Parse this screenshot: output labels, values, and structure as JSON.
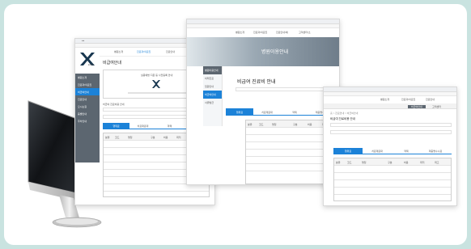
{
  "win1": {
    "logo_text": "EXPO",
    "nav": [
      "병원소개",
      "진료과/의료진",
      "진료안내",
      "고객소통센터"
    ],
    "page_title": "비급여안내",
    "sidebar": [
      "병원소개",
      "진료과/의료진",
      "비급여안내",
      "진료안내",
      "오시는길",
      "층별안내",
      "주차안내"
    ],
    "notice_title": "실종예방 지문 등 사전등록 안내",
    "section_title": "비급여 진료비용 안내",
    "tabs": [
      "행위료",
      "치료재료대",
      "약제",
      "제증명수수료"
    ],
    "table_headers": [
      "분류",
      "코드",
      "명칭",
      "구분",
      "비용",
      "최저",
      "최고",
      "특이사항"
    ]
  },
  "win2": {
    "nav": [
      "병원소개",
      "진료과/의료진",
      "진료안내/예",
      "고객센터/소"
    ],
    "banner_text": "병원이용안내",
    "page_title": "비급여 진료비 안내",
    "sidebar": [
      "병원이용안내",
      "외래진료",
      "입원안내",
      "비급여안내",
      "서류발급"
    ],
    "tabs": [
      "행위료",
      "치료재료대",
      "약제",
      "제증명수수료"
    ],
    "table_headers": [
      "분류",
      "코드",
      "명칭",
      "구분",
      "비용",
      "최저"
    ]
  },
  "win3": {
    "nav": [
      "병원소개",
      "진료과/의료진",
      "진료안내",
      "비급여안내",
      "고객센터"
    ],
    "breadcrumb": "홈 > 진료안내 > 비급여안내",
    "section_title": "비급여 진료비용 안내",
    "tabs": [
      "행위료",
      "치료재료대",
      "약제",
      "제증명수수료"
    ],
    "table_headers": [
      "분류",
      "코드",
      "명칭",
      "구분",
      "비용",
      "최저",
      "최고"
    ]
  },
  "colors": {
    "frame": "#c9e3e0",
    "accent_blue": "#1c82d8",
    "sidebar_dark": "#5c6670",
    "banner": "#6f7d8a"
  }
}
